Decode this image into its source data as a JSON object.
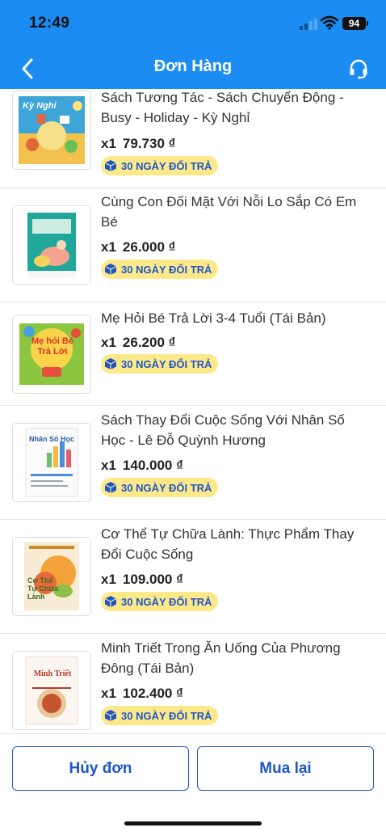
{
  "status_bar": {
    "time": "12:49",
    "battery": "94"
  },
  "header": {
    "title": "Đơn Hàng",
    "back_icon": "chevron-left-icon",
    "support_icon": "headset-icon"
  },
  "items": [
    {
      "title": "Sách Tương Tác - Sách Chuyển Động - Busy - Holiday - Kỳ Nghỉ",
      "qty": "x1",
      "price": "79.730 ₫",
      "badge": "30 NGÀY ĐỔI TRẢ",
      "cover_text": "Kỳ Nghỉ"
    },
    {
      "title": "Cùng Con Đối Mặt Với Nỗi Lo Sắp Có Em Bé",
      "qty": "x1",
      "price": "26.000 ₫",
      "badge": "30 NGÀY ĐỔI TRẢ",
      "cover_text": ""
    },
    {
      "title": "Mẹ Hỏi Bé Trả Lời 3-4 Tuổi (Tái Bản)",
      "qty": "x1",
      "price": "26.200 ₫",
      "badge": "30 NGÀY ĐỔI TRẢ",
      "cover_text": "Mẹ hỏi Bé Trả Lời"
    },
    {
      "title": "Sách Thay Đổi Cuộc Sống Với Nhân Số Học - Lê Đỗ Quỳnh Hương",
      "qty": "x1",
      "price": "140.000 ₫",
      "badge": "30 NGÀY ĐỔI TRẢ",
      "cover_text": "Nhân Số Học"
    },
    {
      "title": "Cơ Thể Tự Chữa Lành: Thực Phẩm Thay Đổi Cuộc Sống",
      "qty": "x1",
      "price": "109.000 ₫",
      "badge": "30 NGÀY ĐỔI TRẢ",
      "cover_text": "Cơ Thể Tự Chữa Lành"
    },
    {
      "title": "Minh Triết Trong Ăn Uống Của Phương Đông (Tái Bản)",
      "qty": "x1",
      "price": "102.400 ₫",
      "badge": "30 NGÀY ĐỔI TRẢ",
      "cover_text": "Minh Triết"
    }
  ],
  "actions": {
    "cancel": "Hủy đơn",
    "rebuy": "Mua lại"
  },
  "colors": {
    "header_bg": "#1b8cf2",
    "accent": "#1e56c8",
    "badge_bg": "#fde98a"
  }
}
